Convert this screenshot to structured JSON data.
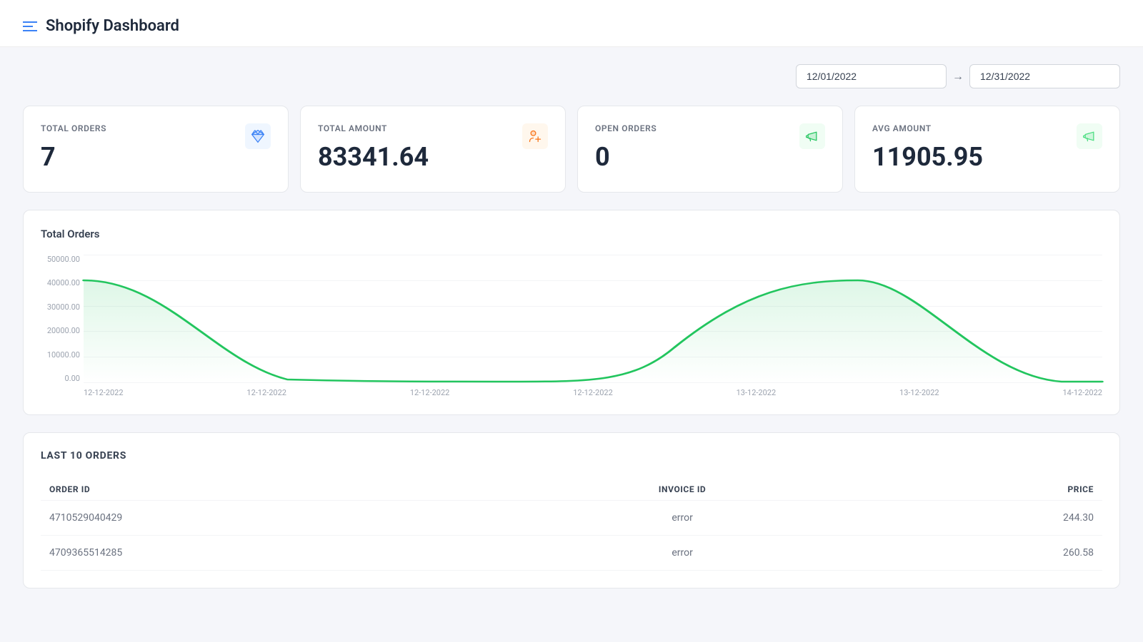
{
  "header": {
    "title": "Shopify Dashboard",
    "menu_icon": "menu-icon"
  },
  "date_filter": {
    "start_date": "12/01/2022",
    "end_date": "12/31/2022",
    "arrow": "→"
  },
  "stats": [
    {
      "label": "TOTAL ORDERS",
      "value": "7",
      "icon": "diamond-icon",
      "icon_type": "blue"
    },
    {
      "label": "TOTAL AMOUNT",
      "value": "83341.64",
      "icon": "user-add-icon",
      "icon_type": "orange"
    },
    {
      "label": "OPEN ORDERS",
      "value": "0",
      "icon": "megaphone-icon",
      "icon_type": "green-light"
    },
    {
      "label": "AVG AMOUNT",
      "value": "11905.95",
      "icon": "megaphone-green-icon",
      "icon_type": "green"
    }
  ],
  "chart": {
    "title": "Total Orders",
    "y_labels": [
      "50000.00",
      "40000.00",
      "30000.00",
      "20000.00",
      "10000.00",
      "0.00"
    ],
    "x_labels": [
      "12-12-2022",
      "12-12-2022",
      "12-12-2022",
      "12-12-2022",
      "13-12-2022",
      "13-12-2022",
      "14-12-2022"
    ]
  },
  "orders_table": {
    "title": "LAST 10 ORDERS",
    "columns": [
      "ORDER ID",
      "INVOICE ID",
      "PRICE"
    ],
    "rows": [
      {
        "order_id": "4710529040429",
        "invoice_id": "error",
        "price": "244.30"
      },
      {
        "order_id": "4709365514285",
        "invoice_id": "error",
        "price": "260.58"
      }
    ]
  }
}
